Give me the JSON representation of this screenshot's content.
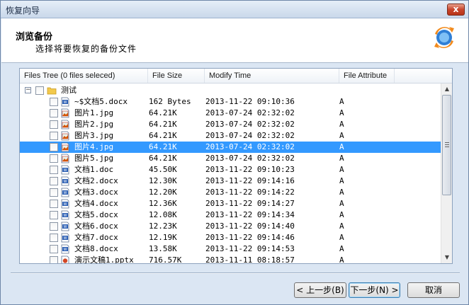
{
  "window": {
    "title": "恢复向导",
    "close_label": "x"
  },
  "header": {
    "title": "浏览备份",
    "subtitle": "选择将要恢复的备份文件"
  },
  "columns": [
    "Files Tree (0 files seleced)",
    "File Size",
    "Modify Time",
    "File Attribute"
  ],
  "root": {
    "label": "测试",
    "expander": "−"
  },
  "files": [
    {
      "name": "~$文档5.docx",
      "size": "162 Bytes",
      "time": "2013-11-22 09:10:36",
      "attr": "A",
      "icon": "word-doc-icon",
      "selected": false
    },
    {
      "name": "图片1.jpg",
      "size": "64.21K",
      "time": "2013-07-24 02:32:02",
      "attr": "A",
      "icon": "image-file-icon",
      "selected": false
    },
    {
      "name": "图片2.jpg",
      "size": "64.21K",
      "time": "2013-07-24 02:32:02",
      "attr": "A",
      "icon": "image-file-icon",
      "selected": false
    },
    {
      "name": "图片3.jpg",
      "size": "64.21K",
      "time": "2013-07-24 02:32:02",
      "attr": "A",
      "icon": "image-file-icon",
      "selected": false
    },
    {
      "name": "图片4.jpg",
      "size": "64.21K",
      "time": "2013-07-24 02:32:02",
      "attr": "A",
      "icon": "image-file-icon",
      "selected": true
    },
    {
      "name": "图片5.jpg",
      "size": "64.21K",
      "time": "2013-07-24 02:32:02",
      "attr": "A",
      "icon": "image-file-icon",
      "selected": false
    },
    {
      "name": "文档1.doc",
      "size": "45.50K",
      "time": "2013-11-22 09:10:23",
      "attr": "A",
      "icon": "word-doc-icon",
      "selected": false
    },
    {
      "name": "文档2.docx",
      "size": "12.30K",
      "time": "2013-11-22 09:14:16",
      "attr": "A",
      "icon": "word-doc-icon",
      "selected": false
    },
    {
      "name": "文档3.docx",
      "size": "12.20K",
      "time": "2013-11-22 09:14:22",
      "attr": "A",
      "icon": "word-doc-icon",
      "selected": false
    },
    {
      "name": "文档4.docx",
      "size": "12.36K",
      "time": "2013-11-22 09:14:27",
      "attr": "A",
      "icon": "word-doc-icon",
      "selected": false
    },
    {
      "name": "文档5.docx",
      "size": "12.08K",
      "time": "2013-11-22 09:14:34",
      "attr": "A",
      "icon": "word-doc-icon",
      "selected": false
    },
    {
      "name": "文档6.docx",
      "size": "12.23K",
      "time": "2013-11-22 09:14:40",
      "attr": "A",
      "icon": "word-doc-icon",
      "selected": false
    },
    {
      "name": "文档7.docx",
      "size": "12.19K",
      "time": "2013-11-22 09:14:46",
      "attr": "A",
      "icon": "word-doc-icon",
      "selected": false
    },
    {
      "name": "文档8.docx",
      "size": "13.58K",
      "time": "2013-11-22 09:14:53",
      "attr": "A",
      "icon": "word-doc-icon",
      "selected": false
    },
    {
      "name": "演示文稿1.pptx",
      "size": "716.57K",
      "time": "2013-11-11 08:18:57",
      "attr": "A",
      "icon": "powerpoint-file-icon",
      "selected": false
    }
  ],
  "buttons": {
    "back": "< 上一步(B)",
    "next": "下一步(N) >",
    "cancel": "取消"
  },
  "colors": {
    "selection": "#3399ff",
    "window_bg": "#dbe6f3"
  }
}
